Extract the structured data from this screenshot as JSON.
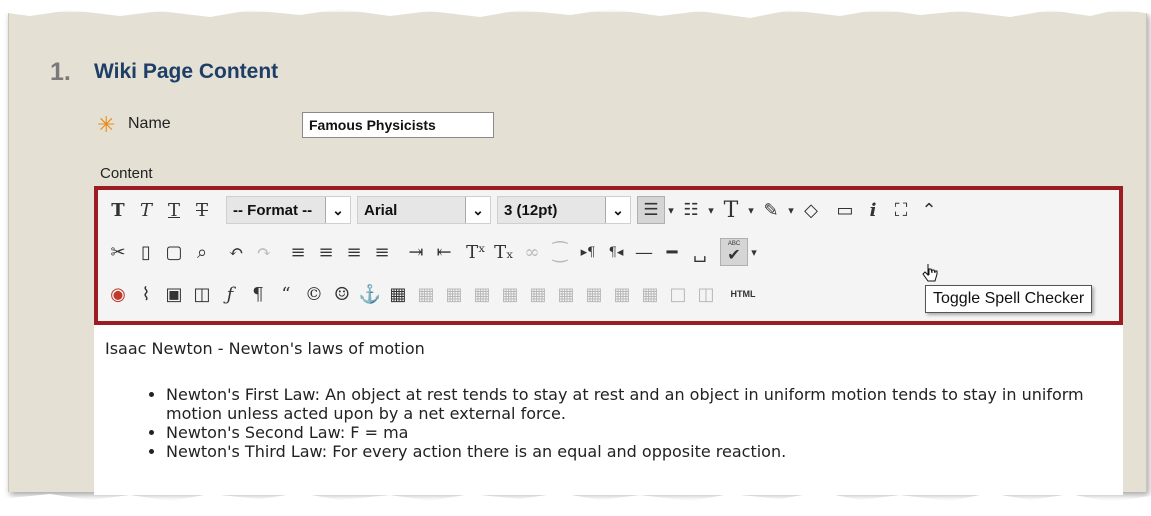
{
  "section": {
    "number": "1.",
    "title": "Wiki Page Content"
  },
  "name_field": {
    "label": "Name",
    "value": "Famous Physicists",
    "required_icon": "asterisk-icon"
  },
  "content_label": "Content",
  "toolbar": {
    "format_select": "-- Format --",
    "font_select": "Arial",
    "size_select": "3 (12pt)",
    "html_label": "HTML",
    "spell_label": "ABC",
    "tooltip": "Toggle Spell Checker"
  },
  "body": {
    "paragraph": "Isaac Newton - Newton's laws of motion",
    "laws": [
      "Newton's First Law: An object at rest tends to stay at rest and an object in uniform motion tends to stay in uniform motion unless acted upon by a net external force.",
      "Newton's Second Law: F = ma",
      "Newton's Third Law: For every action there is an equal and opposite reaction."
    ]
  },
  "colors": {
    "frame_border": "#9b1c22",
    "title_blue": "#1f3e67",
    "required_orange": "#e88a1a",
    "paper": "#e4e1d4"
  }
}
